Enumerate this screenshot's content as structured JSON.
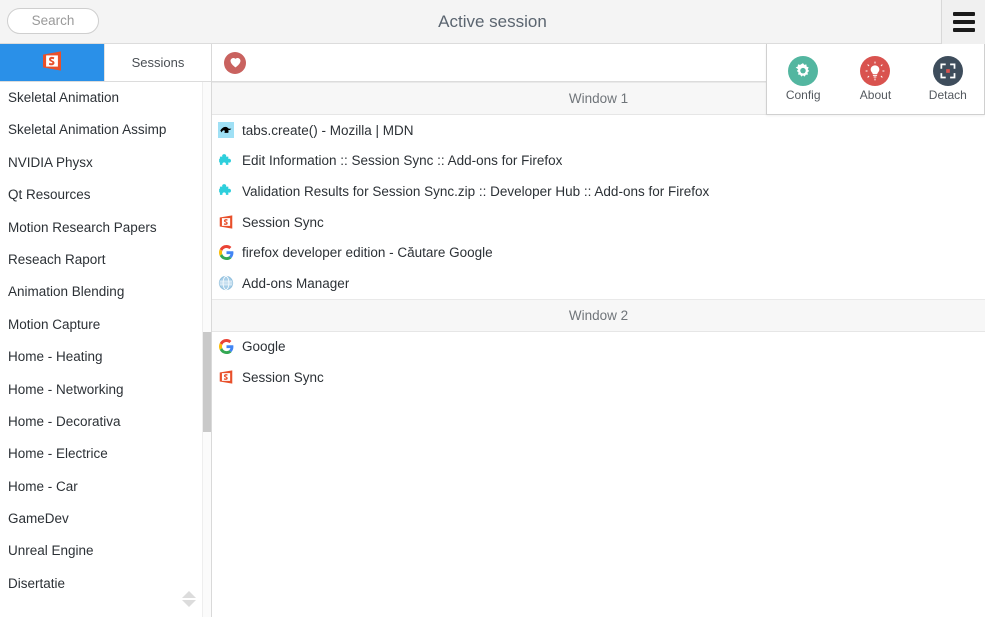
{
  "header": {
    "title": "Active session",
    "search_placeholder": "Search",
    "search_value": "",
    "menu_button_icon": "hamburger-icon"
  },
  "menu": {
    "open": true,
    "items": [
      {
        "label": "Config",
        "icon": "gear-icon",
        "color": "#53b6a0"
      },
      {
        "label": "About",
        "icon": "lightbulb-icon",
        "color": "#d9534f"
      },
      {
        "label": "Detach",
        "icon": "detach-icon",
        "color": "#3e4d5c"
      }
    ]
  },
  "sidebar": {
    "tabs": [
      {
        "label": "",
        "icon": "session-sync-logo",
        "active": true
      },
      {
        "label": "Sessions",
        "icon": "",
        "active": false
      }
    ],
    "items": [
      {
        "label": "Skeletal Animation"
      },
      {
        "label": "Skeletal Animation Assimp"
      },
      {
        "label": "NVIDIA Physx"
      },
      {
        "label": "Qt Resources"
      },
      {
        "label": "Motion Research Papers"
      },
      {
        "label": "Reseach Raport"
      },
      {
        "label": "Animation Blending"
      },
      {
        "label": "Motion Capture"
      },
      {
        "label": "Home - Heating"
      },
      {
        "label": "Home - Networking"
      },
      {
        "label": "Home - Decorativa"
      },
      {
        "label": "Home - Electrice"
      },
      {
        "label": "Home - Car"
      },
      {
        "label": "GameDev"
      },
      {
        "label": "Unreal Engine"
      },
      {
        "label": "Disertatie"
      }
    ]
  },
  "main": {
    "favorites_icon": "heart-icon",
    "windows": [
      {
        "title": "Window 1",
        "tabs": [
          {
            "title": "tabs.create() - Mozilla | MDN",
            "favicon": "mdn-icon"
          },
          {
            "title": "Edit Information :: Session Sync :: Add-ons for Firefox",
            "favicon": "puzzle-icon"
          },
          {
            "title": "Validation Results for Session Sync.zip :: Developer Hub :: Add-ons for Firefox",
            "favicon": "puzzle-icon"
          },
          {
            "title": "Session Sync",
            "favicon": "session-sync-icon"
          },
          {
            "title": "firefox developer edition - Căutare Google",
            "favicon": "google-icon"
          },
          {
            "title": "Add-ons Manager",
            "favicon": "globe-icon"
          }
        ]
      },
      {
        "title": "Window 2",
        "tabs": [
          {
            "title": "Google",
            "favicon": "google-icon"
          },
          {
            "title": "Session Sync",
            "favicon": "session-sync-icon"
          }
        ]
      }
    ]
  },
  "colors": {
    "accent_blue": "#2a90e8",
    "session_sync_red": "#d9432a",
    "heart_red": "#c9625f",
    "puzzle_cyan": "#2ecfdc"
  }
}
